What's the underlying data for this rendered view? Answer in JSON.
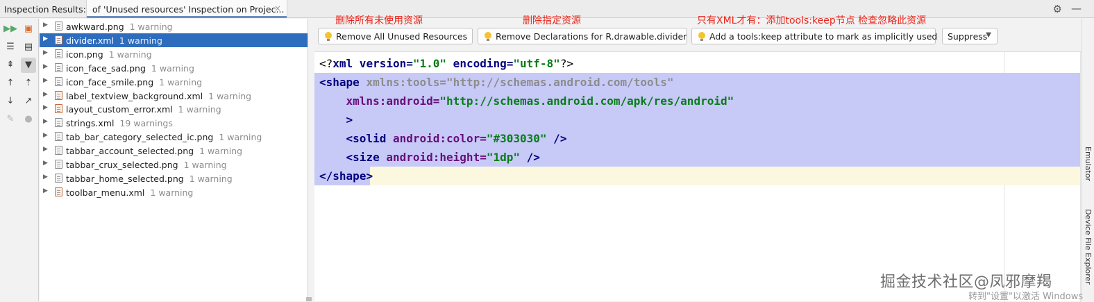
{
  "header": {
    "title": "Inspection Results:",
    "tab_label": "of 'Unused resources' Inspection on Projec...",
    "tab_close": "×",
    "settings_icon": "gear-icon",
    "minimize_icon": "minus-icon"
  },
  "toolbar": {
    "icons": [
      "rerun-icon",
      "export-icon",
      "expand-all-icon",
      "group-icon",
      "collapse-all-icon",
      "filter-icon",
      "previous-icon",
      "autoscroll-icon",
      "next-icon",
      "open-source-icon",
      "settings-wrench-icon",
      "quickfix-bulb-icon"
    ]
  },
  "tree": {
    "items": [
      {
        "name": "awkward.png",
        "warning": "1 warning",
        "type": "png"
      },
      {
        "name": "divider.xml",
        "warning": "1 warning",
        "type": "xml",
        "selected": true
      },
      {
        "name": "icon.png",
        "warning": "1 warning",
        "type": "png"
      },
      {
        "name": "icon_face_sad.png",
        "warning": "1 warning",
        "type": "png"
      },
      {
        "name": "icon_face_smile.png",
        "warning": "1 warning",
        "type": "png"
      },
      {
        "name": "label_textview_background.xml",
        "warning": "1 warning",
        "type": "xml"
      },
      {
        "name": "layout_custom_error.xml",
        "warning": "1 warning",
        "type": "xml"
      },
      {
        "name": "strings.xml",
        "warning": "19 warnings",
        "type": "doc"
      },
      {
        "name": "tab_bar_category_selected_ic.png",
        "warning": "1 warning",
        "type": "png"
      },
      {
        "name": "tabbar_account_selected.png",
        "warning": "1 warning",
        "type": "png"
      },
      {
        "name": "tabbar_crux_selected.png",
        "warning": "1 warning",
        "type": "png"
      },
      {
        "name": "tabbar_home_selected.png",
        "warning": "1 warning",
        "type": "png"
      },
      {
        "name": "toolbar_menu.xml",
        "warning": "1 warning",
        "type": "xml"
      }
    ]
  },
  "annotations": {
    "a1": "删除所有未使用资源",
    "a2": "删除指定资源",
    "a3": "只有XML才有：添加tools:keep节点 检查忽略此资源"
  },
  "actions": {
    "remove_all": "Remove All Unused Resources",
    "remove_decl": "Remove Declarations for R.drawable.divider",
    "add_keep": "Add a tools:keep attribute to mark as implicitly used",
    "suppress": "Suppress",
    "suppress_caret": "▼"
  },
  "code": {
    "l1_open": "<?",
    "l1_tag": "xml",
    "l1_a1": " version=",
    "l1_v1": "\"1.0\"",
    "l1_a2": " encoding=",
    "l1_v2": "\"utf-8\"",
    "l1_close": "?>",
    "l2_open": "<",
    "l2_tag": "shape",
    "l2_attr": " xmlns:tools=",
    "l2_val": "\"http://schemas.android.com/tools\"",
    "l3_attr": "    xmlns:android=",
    "l3_val": "\"http://schemas.android.com/apk/res/android\"",
    "l4": "    >",
    "l5_open": "    <",
    "l5_tag": "solid",
    "l5_attr": " android:color=",
    "l5_val": "\"#303030\"",
    "l5_close": " />",
    "l6_open": "    <",
    "l6_tag": "size",
    "l6_attr": " android:height=",
    "l6_val": "\"1dp\"",
    "l6_close": " />",
    "l7_open": "</",
    "l7_tag": "shape",
    "l7_close": ">"
  },
  "side_panels": {
    "emulator": "Emulator",
    "device_explorer": "Device File Explorer"
  },
  "watermark": "掘金技术社区@凤邪摩羯",
  "windows_notice": "转到\"设置\"以激活 Windows",
  "colors": {
    "selection": "#2e6dbd",
    "annotation": "#e8261c",
    "code_highlight": "#c7c9f7"
  }
}
